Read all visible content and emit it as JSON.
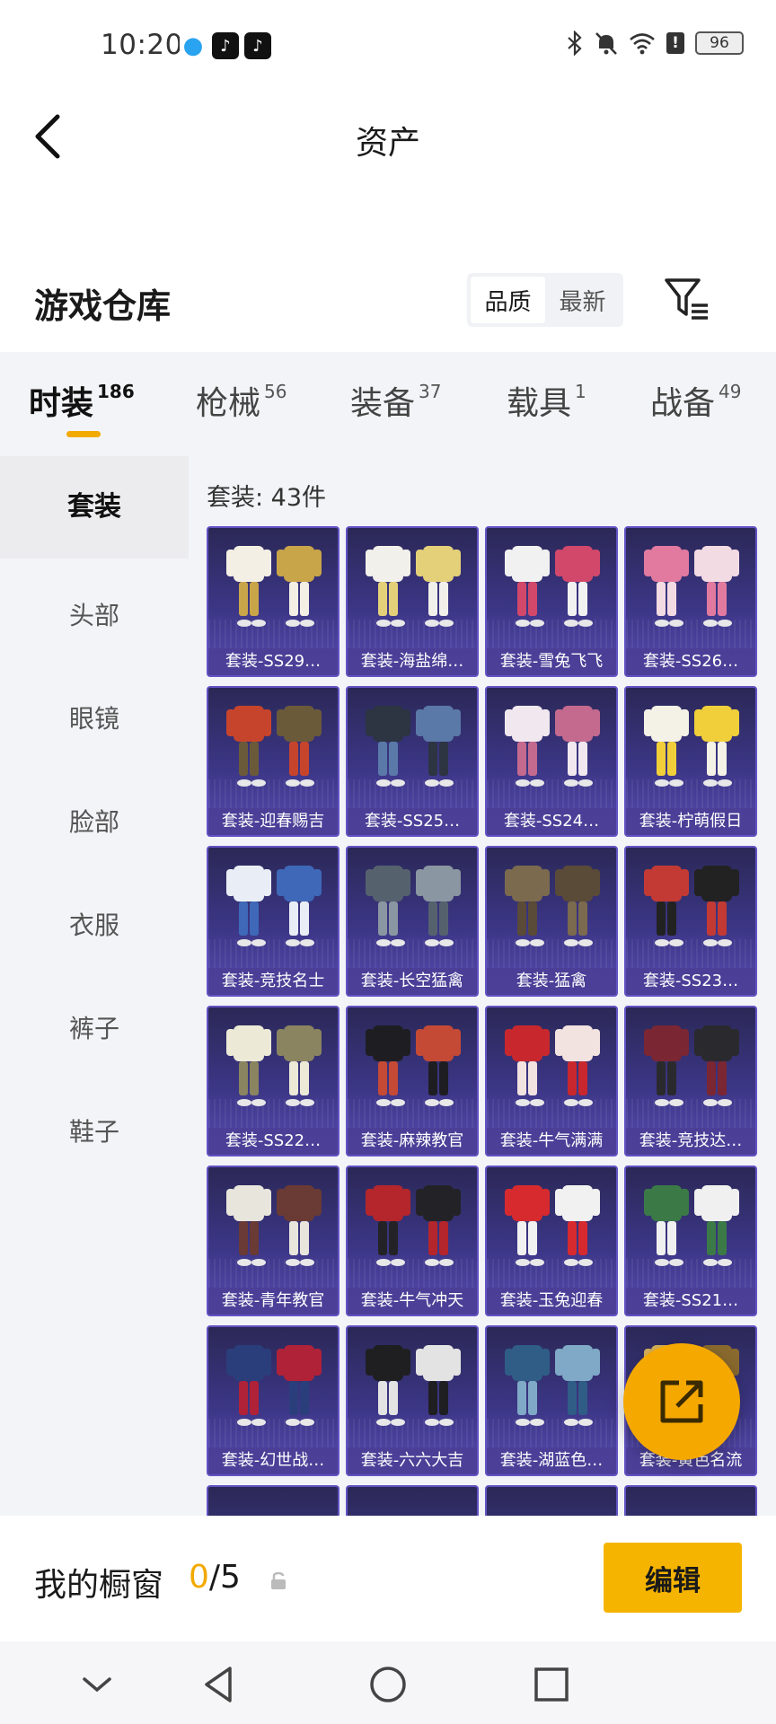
{
  "status_bar": {
    "time": "10:20",
    "battery": "96"
  },
  "header": {
    "title": "资产"
  },
  "warehouse": {
    "title": "游戏仓库",
    "sort_options": [
      "品质",
      "最新"
    ]
  },
  "category_tabs": [
    {
      "label": "时装",
      "count": "186"
    },
    {
      "label": "枪械",
      "count": "56"
    },
    {
      "label": "装备",
      "count": "37"
    },
    {
      "label": "载具",
      "count": "1"
    },
    {
      "label": "战备",
      "count": "49"
    }
  ],
  "sidebar": {
    "items": [
      "套装",
      "头部",
      "眼镜",
      "脸部",
      "衣服",
      "裤子",
      "鞋子"
    ]
  },
  "content": {
    "count_label": "套装: 43件",
    "items": [
      "套装-SS29…",
      "套装-海盐绵…",
      "套装-雪兔飞飞",
      "套装-SS26…",
      "套装-迎春赐吉",
      "套装-SS25…",
      "套装-SS24…",
      "套装-柠萌假日",
      "套装-竞技名士",
      "套装-长空猛禽",
      "套装-猛禽",
      "套装-SS23…",
      "套装-SS22…",
      "套装-麻辣教官",
      "套装-牛气满满",
      "套装-竞技达…",
      "套装-青年教官",
      "套装-牛气冲天",
      "套装-玉兔迎春",
      "套装-SS21…",
      "套装-幻世战…",
      "套装-六六大吉",
      "套装-湖蓝色…",
      "套装-黄色名流"
    ]
  },
  "showcase": {
    "label": "我的橱窗",
    "current": "0",
    "total": "/5",
    "edit_label": "编辑"
  },
  "colors": {
    "accent": "#f5b400",
    "card_bg": "#3c3686",
    "panel_bg": "#f3f4f7"
  }
}
